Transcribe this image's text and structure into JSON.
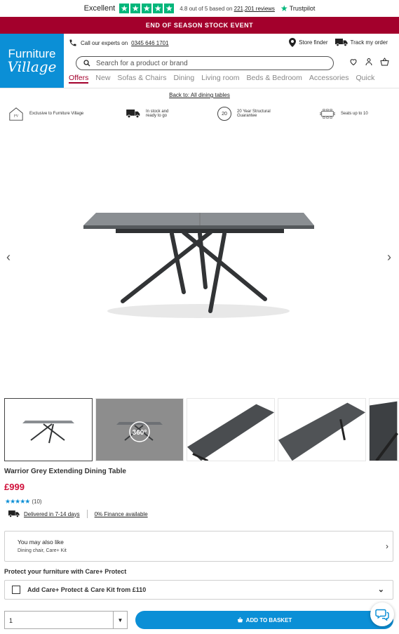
{
  "trustpilot": {
    "excellent": "Excellent",
    "rating_prefix": "4.8 out of 5 based on",
    "reviews_link": "221,201 reviews",
    "brand": "Trustpilot"
  },
  "banner": {
    "text": "END OF SEASON STOCK EVENT"
  },
  "logo": {
    "line1": "Furniture",
    "line2": "Village"
  },
  "header": {
    "call_prefix": "Call our experts on",
    "phone": "0345 646 1701",
    "store_finder": "Store finder",
    "track_order": "Track my order"
  },
  "search": {
    "placeholder": "Search for a product or brand"
  },
  "nav": [
    {
      "label": "Offers"
    },
    {
      "label": "New"
    },
    {
      "label": "Sofas & Chairs"
    },
    {
      "label": "Dining"
    },
    {
      "label": "Living room"
    },
    {
      "label": "Beds & Bedroom"
    },
    {
      "label": "Accessories"
    },
    {
      "label": "Quick"
    }
  ],
  "back_link": "Back to: All dining tables",
  "usps": [
    {
      "text": "Exclusive to Furniture Village",
      "icon": "house-logo-icon"
    },
    {
      "line1": "In stock and",
      "line2": "ready to go",
      "icon": "truck-icon"
    },
    {
      "line1": "20 Year Structural",
      "line2": "Guarantee",
      "badge": "20",
      "icon": "guarantee-20-icon"
    },
    {
      "text": "Seats up to 10",
      "icon": "table-seats-icon"
    }
  ],
  "gallery": {
    "prev": "‹",
    "next": "›",
    "spin_label": "360°"
  },
  "product": {
    "title": "Warrior Grey Extending Dining Table",
    "price": "£999",
    "stars": "★★★★★",
    "review_count": "(10)",
    "delivery": "Delivered in 7-14 days",
    "finance": "0% Finance available"
  },
  "also_like": {
    "title": "You may also like",
    "subtitle": "Dining chair, Care+ Kit",
    "chevron": "›"
  },
  "protect": {
    "heading": "Protect your furniture with Care+ Protect",
    "option": "Add Care+ Protect & Care Kit from £110",
    "chevron": "⌄"
  },
  "purchase": {
    "quantity": "1",
    "dropdown": "▼",
    "basket_label": "ADD TO BASKET"
  },
  "colors": {
    "brand_blue": "#0b8fd6",
    "brand_red": "#a3002c",
    "price_red": "#d0103a",
    "trustpilot_green": "#00b67a"
  }
}
